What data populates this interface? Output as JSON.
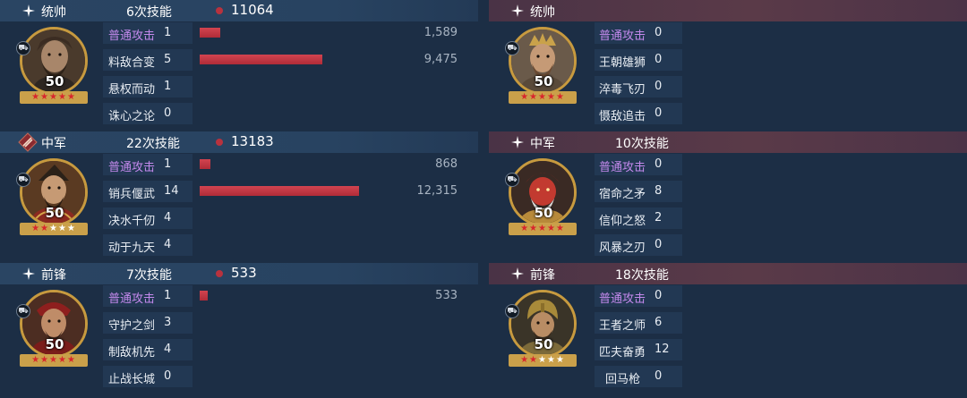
{
  "left_team": {
    "sections": [
      {
        "role": "统帅",
        "role_icon": "sparkle-icon",
        "skill_count": "6次技能",
        "damage_total": "11064",
        "level": "50",
        "stars": [
          "r",
          "r",
          "r",
          "r",
          "r"
        ],
        "skills": [
          {
            "name": "普通攻击",
            "uses": "1",
            "damage": "1,589",
            "bar_fraction": 0.168,
            "normal": true
          },
          {
            "name": "料敌合变",
            "uses": "5",
            "damage": "9,475",
            "bar_fraction": 1.0,
            "normal": false
          },
          {
            "name": "悬权而动",
            "uses": "1",
            "damage": "",
            "bar_fraction": 0,
            "normal": false
          },
          {
            "name": "诛心之论",
            "uses": "0",
            "damage": "",
            "bar_fraction": 0,
            "normal": false
          }
        ]
      },
      {
        "role": "中军",
        "role_icon": "diamond-banner-icon",
        "skill_count": "22次技能",
        "damage_total": "13183",
        "level": "50",
        "stars": [
          "r",
          "r",
          "w",
          "w",
          "w"
        ],
        "skills": [
          {
            "name": "普通攻击",
            "uses": "1",
            "damage": "868",
            "bar_fraction": 0.07,
            "normal": true
          },
          {
            "name": "销兵偃武",
            "uses": "14",
            "damage": "12,315",
            "bar_fraction": 1.0,
            "normal": false
          },
          {
            "name": "决水千仞",
            "uses": "4",
            "damage": "",
            "bar_fraction": 0,
            "normal": false
          },
          {
            "name": "动于九天",
            "uses": "4",
            "damage": "",
            "bar_fraction": 0,
            "normal": false
          }
        ]
      },
      {
        "role": "前锋",
        "role_icon": "sparkle-icon",
        "skill_count": "7次技能",
        "damage_total": "533",
        "level": "50",
        "stars": [
          "r",
          "r",
          "r",
          "r",
          "r"
        ],
        "skills": [
          {
            "name": "普通攻击",
            "uses": "1",
            "damage": "533",
            "bar_fraction": 0.05,
            "normal": true
          },
          {
            "name": "守护之剑",
            "uses": "3",
            "damage": "",
            "bar_fraction": 0,
            "normal": false
          },
          {
            "name": "制敌机先",
            "uses": "4",
            "damage": "",
            "bar_fraction": 0,
            "normal": false
          },
          {
            "name": "止战长城",
            "uses": "0",
            "damage": "",
            "bar_fraction": 0,
            "normal": false
          }
        ]
      }
    ]
  },
  "right_team": {
    "sections": [
      {
        "role": "统帅",
        "role_icon": "sparkle-icon",
        "skill_count": "",
        "level": "50",
        "stars": [
          "r",
          "r",
          "r",
          "r",
          "r"
        ],
        "skills": [
          {
            "name": "普通攻击",
            "uses": "0",
            "normal": true
          },
          {
            "name": "王朝雄狮",
            "uses": "0",
            "normal": false
          },
          {
            "name": "淬毒飞刃",
            "uses": "0",
            "normal": false
          },
          {
            "name": "慑敌追击",
            "uses": "0",
            "normal": false
          }
        ]
      },
      {
        "role": "中军",
        "role_icon": "sparkle-icon",
        "skill_count": "10次技能",
        "level": "50",
        "stars": [
          "r",
          "r",
          "r",
          "r",
          "r"
        ],
        "skills": [
          {
            "name": "普通攻击",
            "uses": "0",
            "normal": true
          },
          {
            "name": "宿命之矛",
            "uses": "8",
            "normal": false
          },
          {
            "name": "信仰之怒",
            "uses": "2",
            "normal": false
          },
          {
            "name": "风暴之刃",
            "uses": "0",
            "normal": false
          }
        ]
      },
      {
        "role": "前锋",
        "role_icon": "sparkle-icon",
        "skill_count": "18次技能",
        "level": "50",
        "stars": [
          "r",
          "r",
          "w",
          "w",
          "w"
        ],
        "skills": [
          {
            "name": "普通攻击",
            "uses": "0",
            "normal": true
          },
          {
            "name": "王者之师",
            "uses": "6",
            "normal": false
          },
          {
            "name": "匹夫奋勇",
            "uses": "12",
            "normal": false
          },
          {
            "name": "回马枪",
            "uses": "0",
            "normal": false
          }
        ]
      }
    ]
  },
  "colors": {
    "background": "#1c2e45",
    "left_header": "#2a4563",
    "right_header": "#5a3a48",
    "damage_bar": "#c0323f",
    "normal_attack_text": "#c389ec",
    "portrait_border": "#c79a3f"
  }
}
